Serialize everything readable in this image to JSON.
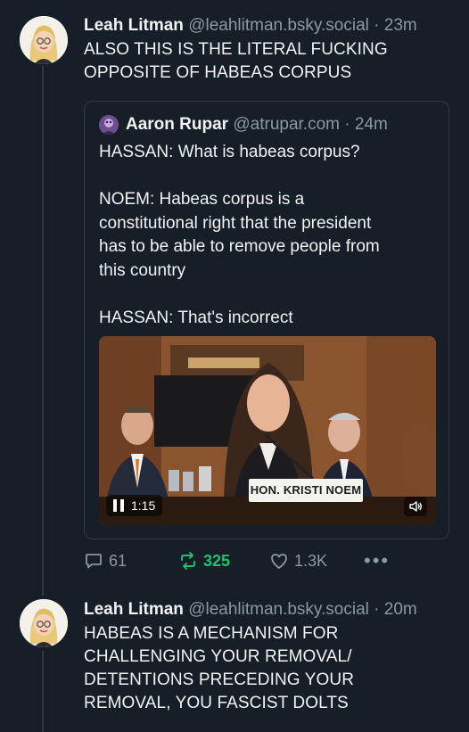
{
  "post1": {
    "author": "Leah Litman",
    "handle": "@leahlitman.bsky.social",
    "separator": "·",
    "time": "23m",
    "text_line1": "ALSO THIS IS THE LITERAL FUCKING",
    "text_line2": "OPPOSITE OF HABEAS CORPUS"
  },
  "quote": {
    "author": "Aaron Rupar",
    "handle": "@atrupar.com",
    "separator": "·",
    "time": "24m",
    "lines": [
      "HASSAN: What is habeas corpus?",
      "",
      "NOEM: Habeas corpus is a",
      "constitutional right that the president",
      "has to be able to remove people from",
      "this country",
      "",
      "HASSAN: That's incorrect"
    ],
    "video": {
      "nameplate": "HON. KRISTI NOEM",
      "duration": "1:15"
    }
  },
  "actions": {
    "replies": "61",
    "reposts": "325",
    "likes": "1.3K",
    "more": "•••"
  },
  "post2": {
    "author": "Leah Litman",
    "handle": "@leahlitman.bsky.social",
    "separator": "·",
    "time": "20m",
    "text_line1": "HABEAS IS A MECHANISM FOR",
    "text_line2": "CHALLENGING YOUR REMOVAL/",
    "text_line3": "DETENTIONS PRECEDING YOUR",
    "text_line4": "REMOVAL, YOU FASCIST DOLTS"
  },
  "colors": {
    "background": "#161e27",
    "muted": "#8b98a5",
    "repost_active": "#18c56e"
  }
}
